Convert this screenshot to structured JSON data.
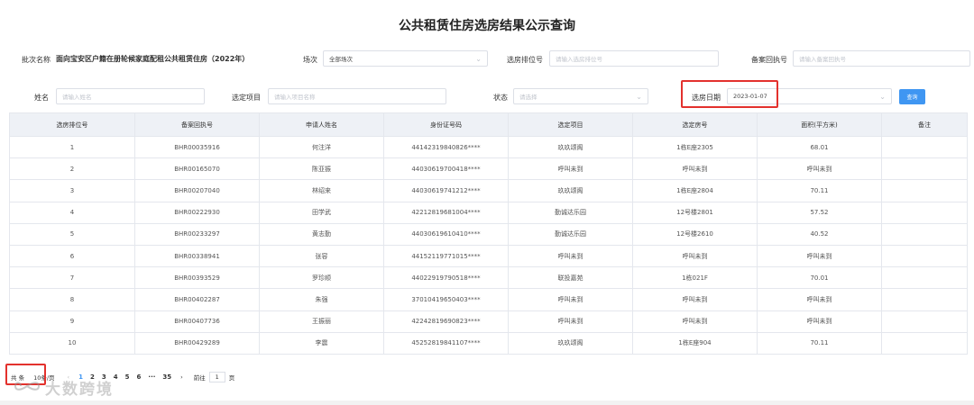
{
  "page": {
    "title": "公共租赁住房选房结果公示查询"
  },
  "filters": {
    "batch_label": "批次名称",
    "batch_value": "面向宝安区户籍在册轮候家庭配租公共租赁住房（2022年）",
    "session_label": "场次",
    "session_value": "全部场次",
    "rank_label": "选房排位号",
    "rank_placeholder": "请输入选房排位号",
    "receipt_label": "备案回执号",
    "receipt_placeholder": "请输入备案回执号",
    "name_label": "姓名",
    "name_placeholder": "请输入姓名",
    "project_label": "选定项目",
    "project_placeholder": "请输入项目名称",
    "status_label": "状态",
    "status_placeholder": "请选择",
    "date_label": "选房日期",
    "date_value": "2023-01-07",
    "query_label": "查询"
  },
  "table": {
    "headers": [
      "选房排位号",
      "备案回执号",
      "申请人姓名",
      "身份证号码",
      "选定项目",
      "选定房号",
      "面积(平方米)",
      "备注"
    ],
    "rows": [
      [
        "1",
        "BHR00035916",
        "何注洋",
        "44142319840826****",
        "玖玖颂阁",
        "1栋E座2305",
        "68.01",
        ""
      ],
      [
        "2",
        "BHR00165070",
        "陈亚振",
        "44030619700418****",
        "呼叫未到",
        "呼叫未到",
        "呼叫未到",
        ""
      ],
      [
        "3",
        "BHR00207040",
        "林绍来",
        "44030619741212****",
        "玖玖颂阁",
        "1栋E座2804",
        "70.11",
        ""
      ],
      [
        "4",
        "BHR00222930",
        "田学武",
        "42212819681004****",
        "勤诚达乐园",
        "12号楼2801",
        "57.52",
        ""
      ],
      [
        "5",
        "BHR00233297",
        "黄志勤",
        "44030619610410****",
        "勤诚达乐园",
        "12号楼2610",
        "40.52",
        ""
      ],
      [
        "6",
        "BHR00338941",
        "张容",
        "44152119771015****",
        "呼叫未到",
        "呼叫未到",
        "呼叫未到",
        ""
      ],
      [
        "7",
        "BHR00393529",
        "罗珍顺",
        "44022919790518****",
        "联投嘉苑",
        "1栋021F",
        "70.01",
        ""
      ],
      [
        "8",
        "BHR00402287",
        "朱强",
        "37010419650403****",
        "呼叫未到",
        "呼叫未到",
        "呼叫未到",
        ""
      ],
      [
        "9",
        "BHR00407736",
        "王振丽",
        "42242819690823****",
        "呼叫未到",
        "呼叫未到",
        "呼叫未到",
        ""
      ],
      [
        "10",
        "BHR00429289",
        "李震",
        "45252819841107****",
        "玖玖颂阁",
        "1栋E座904",
        "70.11",
        ""
      ]
    ]
  },
  "pagination": {
    "total": "共 条",
    "page_size": "10条/页",
    "prev": "‹",
    "pages": [
      "1",
      "2",
      "3",
      "4",
      "5",
      "6",
      "···",
      "35"
    ],
    "current": "1",
    "next": "›",
    "goto_prefix": "前往",
    "goto_value": "1",
    "goto_suffix": "页"
  },
  "watermark": {
    "text": "大数跨境",
    "icon": "infinity-logo-icon"
  },
  "colors": {
    "accent": "#3f96f2",
    "highlight_box": "#e3312d",
    "header_bg": "#eef1f6"
  }
}
